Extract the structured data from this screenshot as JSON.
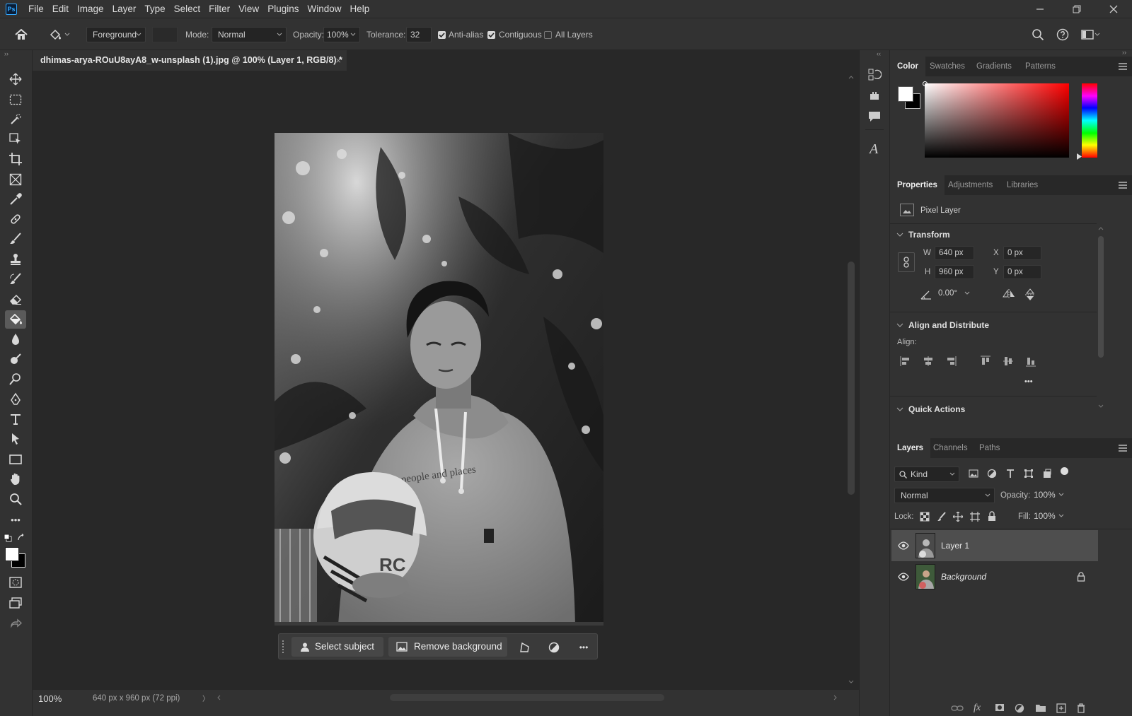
{
  "app": {
    "logo_text": "Ps"
  },
  "menu": [
    "File",
    "Edit",
    "Image",
    "Layer",
    "Type",
    "Select",
    "Filter",
    "View",
    "Plugins",
    "Window",
    "Help"
  ],
  "options_bar": {
    "fill_source": "Foreground",
    "mode_label": "Mode:",
    "mode_value": "Normal",
    "opacity_label": "Opacity:",
    "opacity_value": "100%",
    "tolerance_label": "Tolerance:",
    "tolerance_value": "32",
    "anti_alias": {
      "label": "Anti-alias",
      "checked": true
    },
    "contiguous": {
      "label": "Contiguous",
      "checked": true
    },
    "all_layers": {
      "label": "All Layers",
      "checked": false
    }
  },
  "document": {
    "tab_title": "dhimas-arya-ROuU8ayA8_w-unsplash (1).jpg @ 100% (Layer 1, RGB/8) *",
    "close_glyph": "×"
  },
  "contextual_taskbar": {
    "select_subject": "Select subject",
    "remove_background": "Remove background",
    "more_glyph": "•••"
  },
  "status_bar": {
    "zoom": "100%",
    "doc_info": "640 px x 960 px (72 ppi)",
    "arrow_glyph": "〉"
  },
  "color_panel": {
    "tabs": [
      "Color",
      "Swatches",
      "Gradients",
      "Patterns"
    ],
    "active_tab": "Color",
    "foreground_color": "#ffffff",
    "background_color": "#000000",
    "picker_hue": "#ff0000"
  },
  "properties_panel": {
    "tabs": [
      "Properties",
      "Adjustments",
      "Libraries"
    ],
    "active_tab": "Properties",
    "layer_type": "Pixel Layer",
    "transform": {
      "title": "Transform",
      "w_label": "W",
      "w_value": "640 px",
      "h_label": "H",
      "h_value": "960 px",
      "x_label": "X",
      "x_value": "0 px",
      "y_label": "Y",
      "y_value": "0 px",
      "angle_value": "0.00°"
    },
    "align": {
      "title": "Align and Distribute",
      "align_label": "Align:",
      "more_glyph": "•••"
    },
    "quick_actions": {
      "title": "Quick Actions"
    }
  },
  "layers_panel": {
    "tabs": [
      "Layers",
      "Channels",
      "Paths"
    ],
    "active_tab": "Layers",
    "filter_kind": "Kind",
    "blend_mode": "Normal",
    "opacity_label": "Opacity:",
    "opacity_value": "100%",
    "lock_label": "Lock:",
    "fill_label": "Fill:",
    "fill_value": "100%",
    "layers": [
      {
        "name": "Layer 1",
        "visible": true,
        "selected": true,
        "locked": false
      },
      {
        "name": "Background",
        "visible": true,
        "selected": false,
        "locked": true
      }
    ],
    "footer_fx": "fx"
  }
}
